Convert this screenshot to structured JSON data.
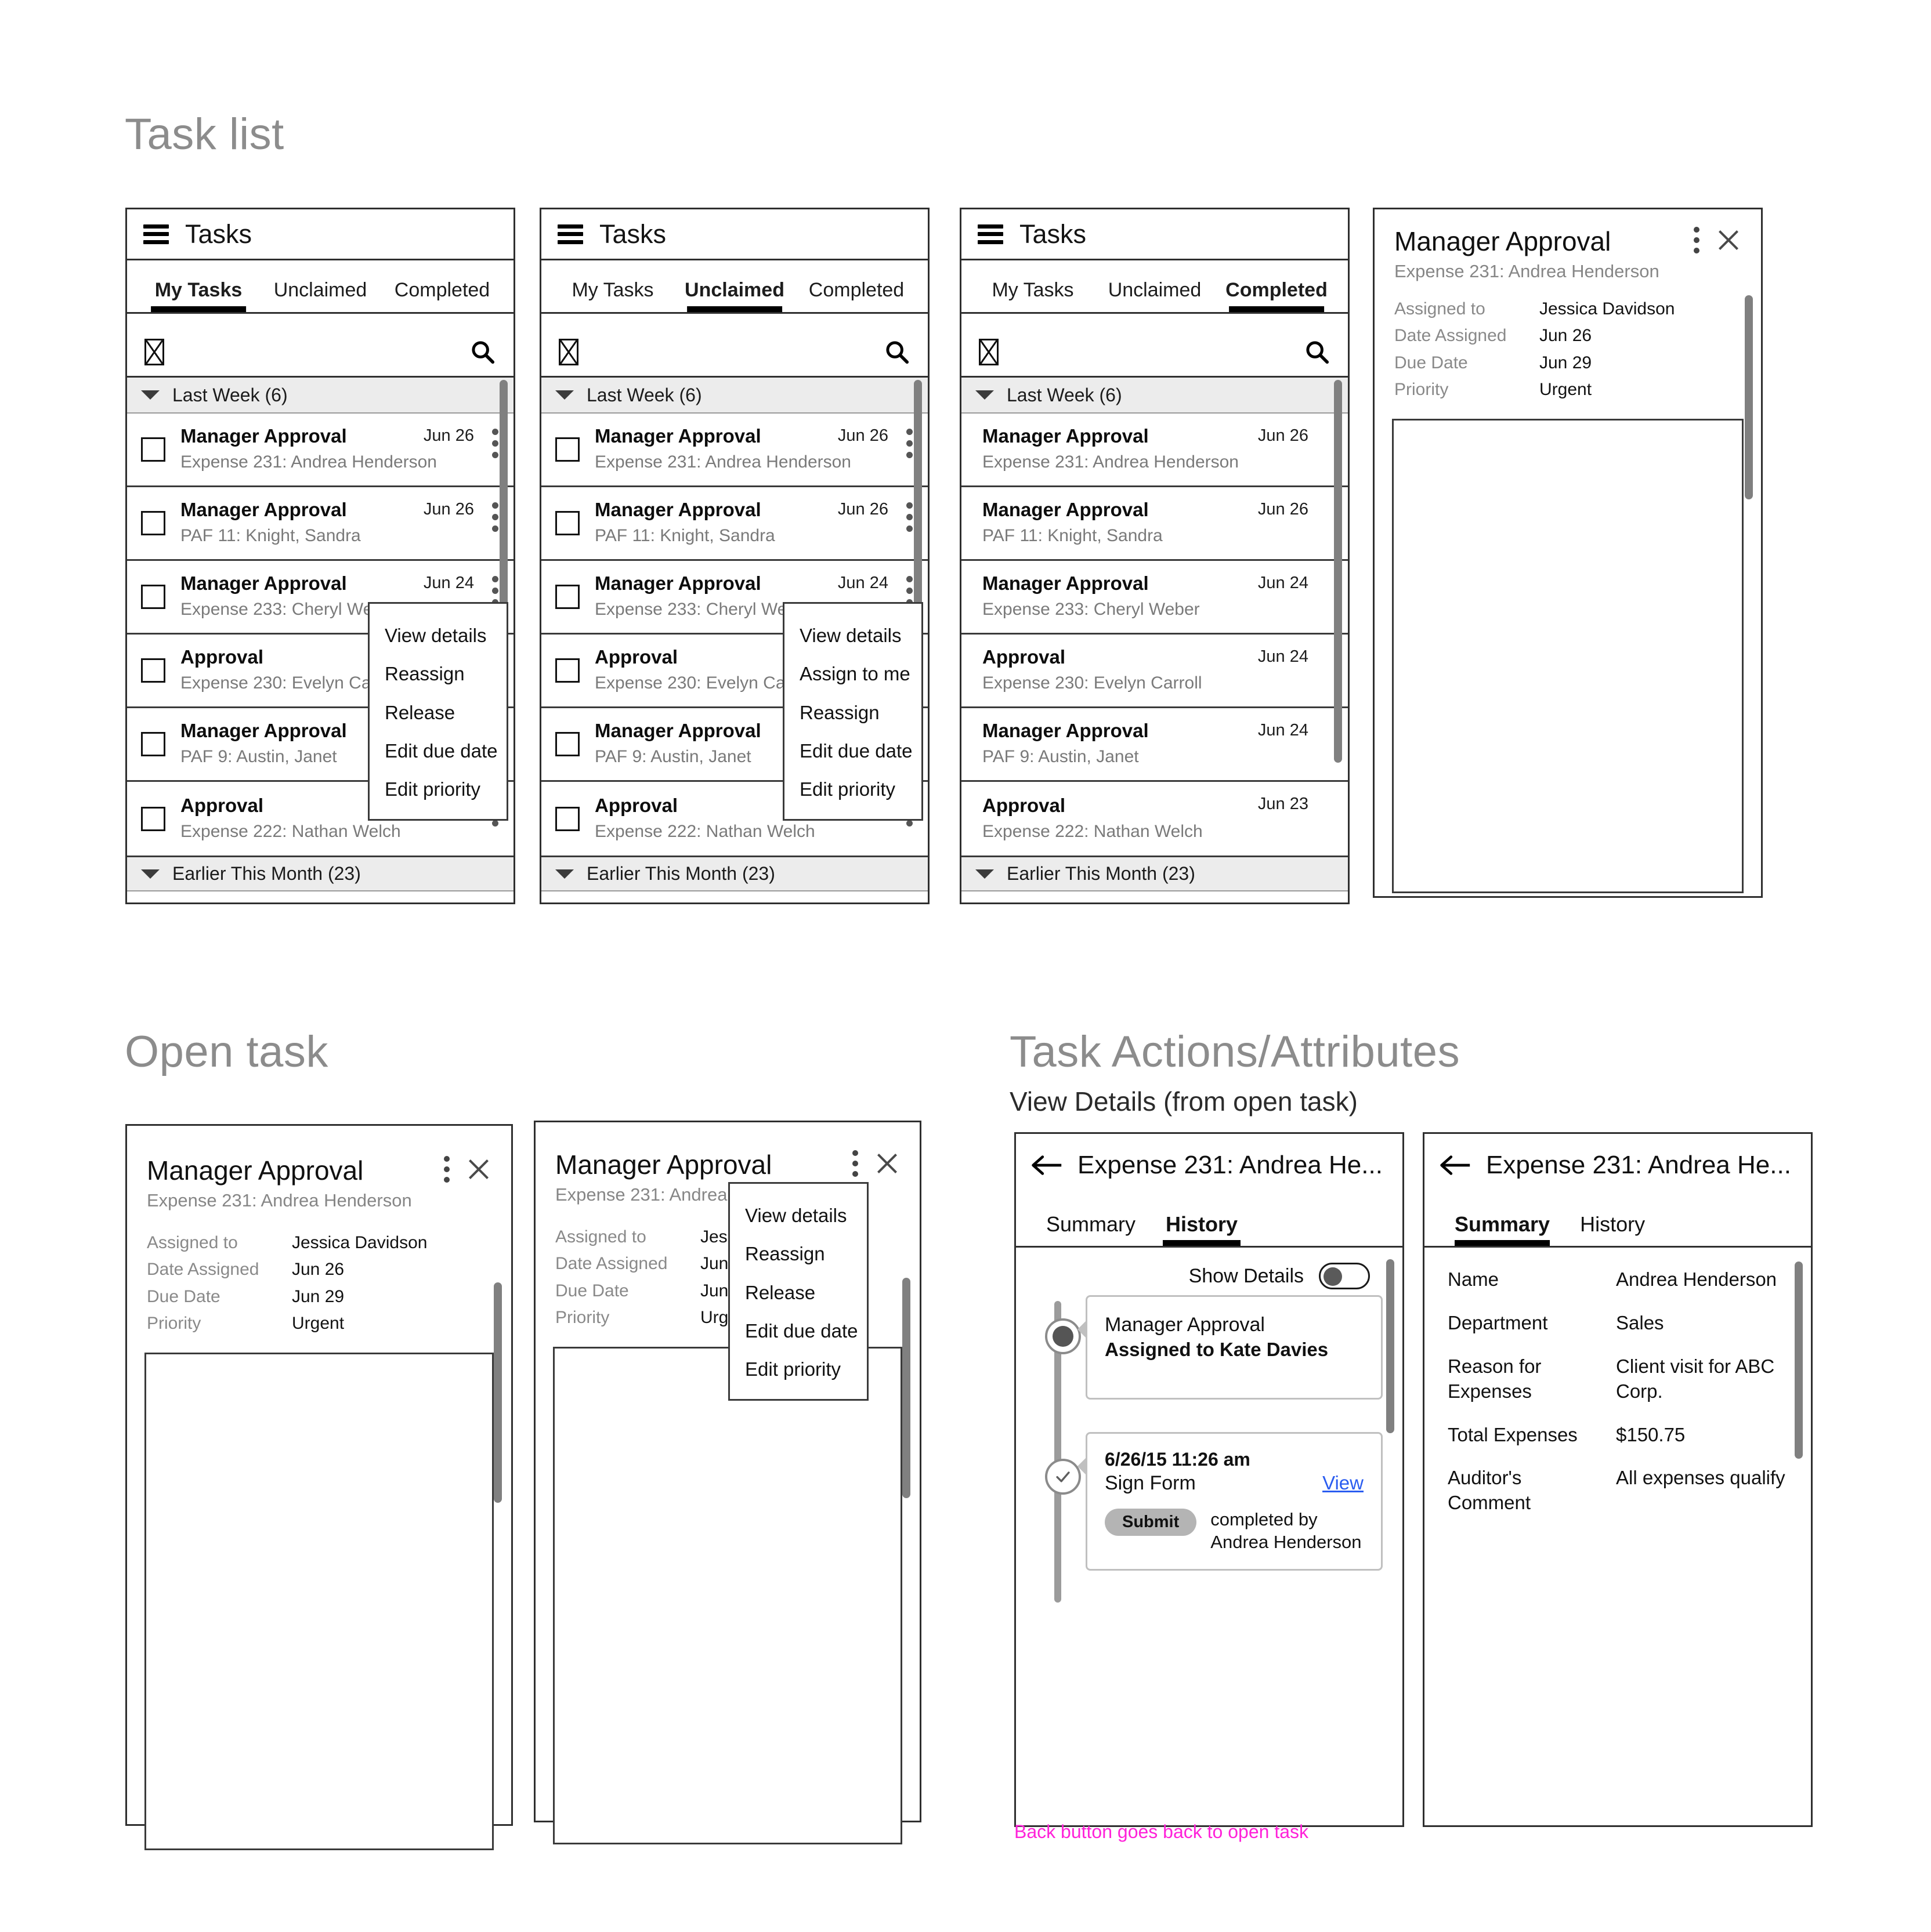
{
  "sections": {
    "task_list_title": "Task list",
    "open_task_title": "Open task",
    "task_actions_title": "Task Actions/Attributes",
    "view_details_subtitle": "View Details (from open task)",
    "back_note": "Back button goes back to open task"
  },
  "appbar": {
    "title": "Tasks",
    "menu_icon": "hamburger-icon"
  },
  "tabs": [
    {
      "label": "My Tasks"
    },
    {
      "label": "Unclaimed"
    },
    {
      "label": "Completed"
    }
  ],
  "search": {
    "placeholder": "",
    "value": "",
    "icon": "search-icon",
    "left_icon": "image-placeholder-icon"
  },
  "groups": {
    "last_week": "Last Week (6)",
    "earlier_this_month": "Earlier This Month (23)"
  },
  "tasks": [
    {
      "title": "Manager Approval",
      "subtitle": "Expense 231: Andrea Henderson",
      "date": "Jun 26"
    },
    {
      "title": "Manager Approval",
      "subtitle": "PAF 11: Knight, Sandra",
      "date": "Jun 26"
    },
    {
      "title": "Manager Approval",
      "subtitle": "Expense 233: Cheryl Weber",
      "date": "Jun 24"
    },
    {
      "title": "Approval",
      "subtitle": "Expense 230: Evelyn Carroll",
      "date": "Jun 24"
    },
    {
      "title": "Manager Approval",
      "subtitle": "PAF 9: Austin, Janet",
      "date": "Jun 24"
    },
    {
      "title": "Approval",
      "subtitle": "Expense 222: Nathan Welch",
      "date": "Jun 23"
    }
  ],
  "menus": {
    "my_tasks": [
      "View details",
      "Reassign",
      "Release",
      "Edit due date",
      "Edit priority"
    ],
    "unclaimed": [
      "View details",
      "Assign to me",
      "Reassign",
      "Edit due date",
      "Edit priority"
    ],
    "open_task": [
      "View details",
      "Reassign",
      "Release",
      "Edit due date",
      "Edit priority"
    ]
  },
  "detail": {
    "title": "Manager Approval",
    "subtitle": "Expense 231: Andrea Henderson",
    "fields": [
      {
        "key": "Assigned to",
        "value": "Jessica Davidson"
      },
      {
        "key": "Date Assigned",
        "value": "Jun 26"
      },
      {
        "key": "Due Date",
        "value": "Jun 29"
      },
      {
        "key": "Priority",
        "value": "Urgent"
      }
    ],
    "fields_truncated": [
      {
        "key": "Assigned to",
        "value": "Jes"
      },
      {
        "key": "Date Assigned",
        "value": "Jun"
      },
      {
        "key": "Due Date",
        "value": "Jun"
      },
      {
        "key": "Priority",
        "value": "Urg"
      }
    ],
    "subtitle_truncated": "Expense 231: Andrea",
    "kebab_icon": "kebab-menu-icon",
    "close_icon": "close-icon"
  },
  "view_details": {
    "title": "Expense 231: Andrea He...",
    "back_icon": "back-arrow-icon",
    "tabs": [
      {
        "label": "Summary"
      },
      {
        "label": "History"
      }
    ],
    "history": {
      "show_details_label": "Show Details",
      "toggle_state": "off",
      "events": [
        {
          "icon": "filled-dot-icon",
          "line1": "Manager Approval",
          "line2": "Assigned to Kate Davies"
        },
        {
          "icon": "check-circle-icon",
          "timestamp": "6/26/15 11:26 am",
          "line1": "Sign Form",
          "link": "View",
          "pill": "Submit",
          "completed_by": "completed by Andrea Henderson"
        }
      ]
    },
    "summary": [
      {
        "key": "Name",
        "value": "Andrea Henderson"
      },
      {
        "key": "Department",
        "value": "Sales"
      },
      {
        "key": "Reason for Expenses",
        "value": "Client visit for ABC Corp."
      },
      {
        "key": "Total Expenses",
        "value": "$150.75"
      },
      {
        "key": "Auditor's Comment",
        "value": "All expenses qualify"
      }
    ]
  },
  "colors": {
    "border": "#2f2f2f",
    "group_bg": "#ececec",
    "muted": "#7a7a7a",
    "link": "#2a5cf0",
    "note": "#ff22d9",
    "heading": "#8c8c8c"
  }
}
